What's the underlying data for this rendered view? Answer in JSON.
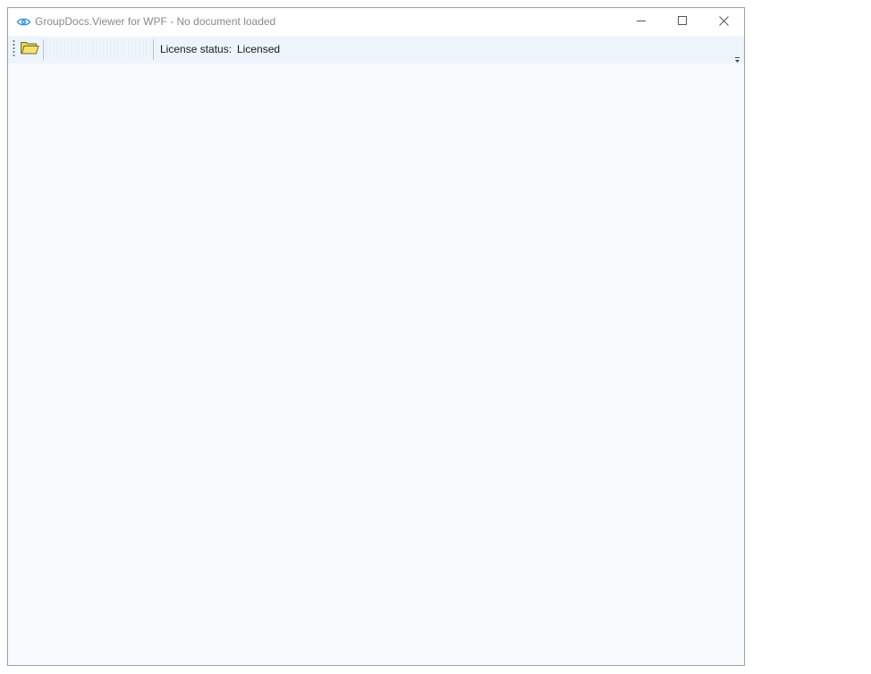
{
  "window": {
    "title": "GroupDocs.Viewer for WPF - No document loaded",
    "app_icon": "eye-icon",
    "controls": {
      "minimize_icon": "minimize-icon",
      "maximize_icon": "maximize-icon",
      "close_icon": "close-icon"
    }
  },
  "toolbar": {
    "open_icon": "folder-open-icon",
    "license_label": "License status:",
    "license_value": "Licensed",
    "overflow_icon": "toolbar-overflow-icon"
  },
  "colors": {
    "window_background": "#f7fbfe",
    "toolbar_background": "#edf4fb",
    "title_text": "#8a8a8a",
    "folder_fill": "#f2e46b",
    "eye_icon": "#3a8fd6"
  }
}
